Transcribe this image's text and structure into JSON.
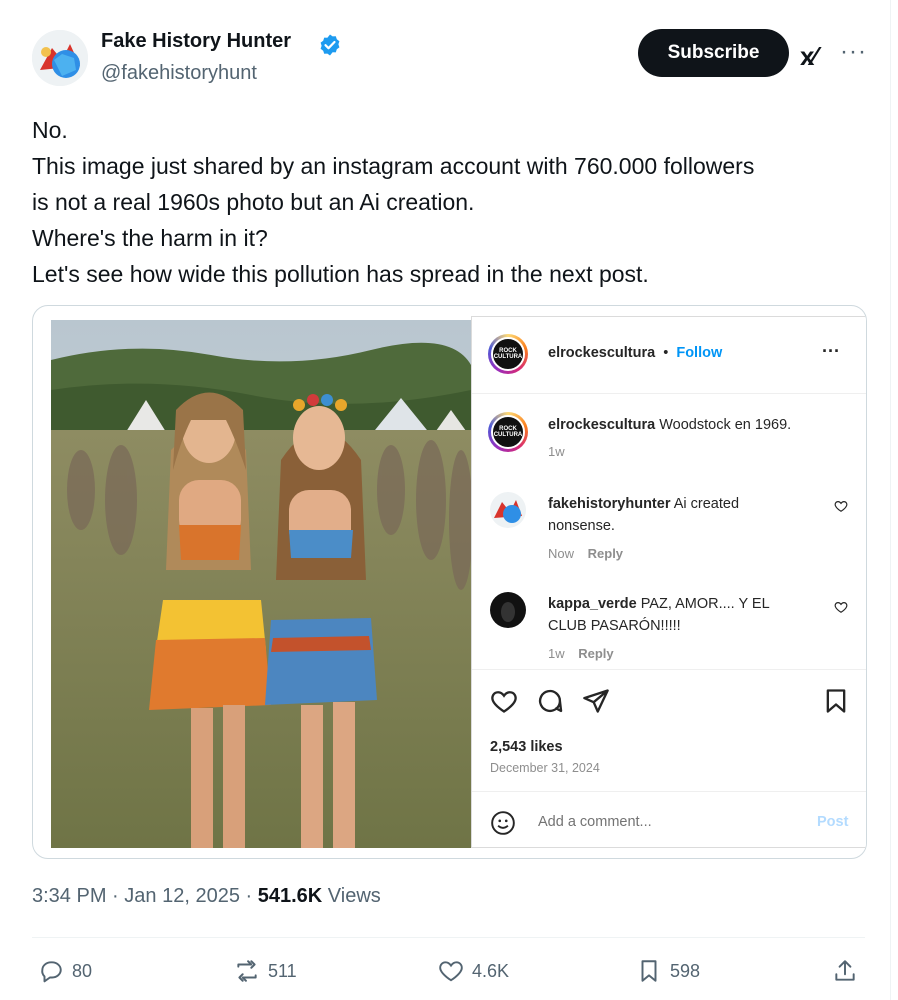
{
  "author": {
    "name": "Fake History Hunter",
    "handle": "@fakehistoryhunt",
    "subscribe_label": "Subscribe",
    "grok_label": "x⁄",
    "more_label": "···"
  },
  "tweet": {
    "lines": [
      "No.",
      "This image just shared by an instagram account with 760.000 followers",
      "is not a real 1960s photo but an Ai creation.",
      "Where's the harm in it?",
      "Let's see how wide this pollution has spread in the next post."
    ]
  },
  "instagram": {
    "account": "elrockescultura",
    "dot": "•",
    "follow": "Follow",
    "more": "···",
    "logo_text": "ROCK CULTURA",
    "caption_user": "elrockescultura",
    "caption_text": "Woodstock en 1969.",
    "caption_time": "1w",
    "comments": [
      {
        "user": "fakehistoryhunter",
        "text_line1": "Ai created",
        "text_line2": "nonsense.",
        "time": "Now",
        "reply": "Reply"
      },
      {
        "user": "kappa_verde",
        "text_line1": "PAZ, AMOR.... Y EL",
        "text_line2": "CLUB PASARÓN!!!!!",
        "time": "1w",
        "reply": "Reply"
      }
    ],
    "likes": "2,543 likes",
    "date": "December 31, 2024",
    "add_comment_placeholder": "Add a comment...",
    "post_label": "Post"
  },
  "footer": {
    "time": "3:34 PM",
    "sep1": "·",
    "date": "Jan 12, 2025",
    "sep2": "·",
    "views_count": "541.6K",
    "views_label": "Views",
    "replies": "80",
    "reposts": "511",
    "likes": "4.6K",
    "bookmarks": "598"
  },
  "colors": {
    "text": "#0f1419",
    "secondary": "#536471",
    "verified": "#1d9bf0",
    "ig_link": "#0095f6"
  }
}
